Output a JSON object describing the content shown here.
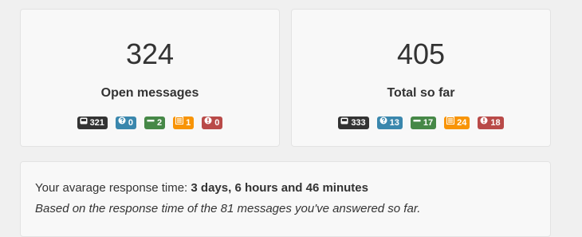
{
  "open_card": {
    "count": "324",
    "label": "Open messages",
    "badges": [
      {
        "icon": "inbox-icon",
        "value": "321",
        "color": "#333333"
      },
      {
        "icon": "question-icon",
        "value": "0",
        "color": "#3a87ad"
      },
      {
        "icon": "minus-icon",
        "value": "2",
        "color": "#468847"
      },
      {
        "icon": "list-icon",
        "value": "1",
        "color": "#f89406"
      },
      {
        "icon": "alert-icon",
        "value": "0",
        "color": "#b94a48"
      }
    ]
  },
  "total_card": {
    "count": "405",
    "label": "Total so far",
    "badges": [
      {
        "icon": "inbox-icon",
        "value": "333",
        "color": "#333333"
      },
      {
        "icon": "question-icon",
        "value": "13",
        "color": "#3a87ad"
      },
      {
        "icon": "minus-icon",
        "value": "17",
        "color": "#468847"
      },
      {
        "icon": "list-icon",
        "value": "24",
        "color": "#f89406"
      },
      {
        "icon": "alert-icon",
        "value": "18",
        "color": "#b94a48"
      }
    ]
  },
  "response": {
    "prefix": "Your avarage response time: ",
    "value": "3 days, 6 hours and 46 minutes",
    "note": "Based on the response time of the 81 messages you've answered so far."
  }
}
